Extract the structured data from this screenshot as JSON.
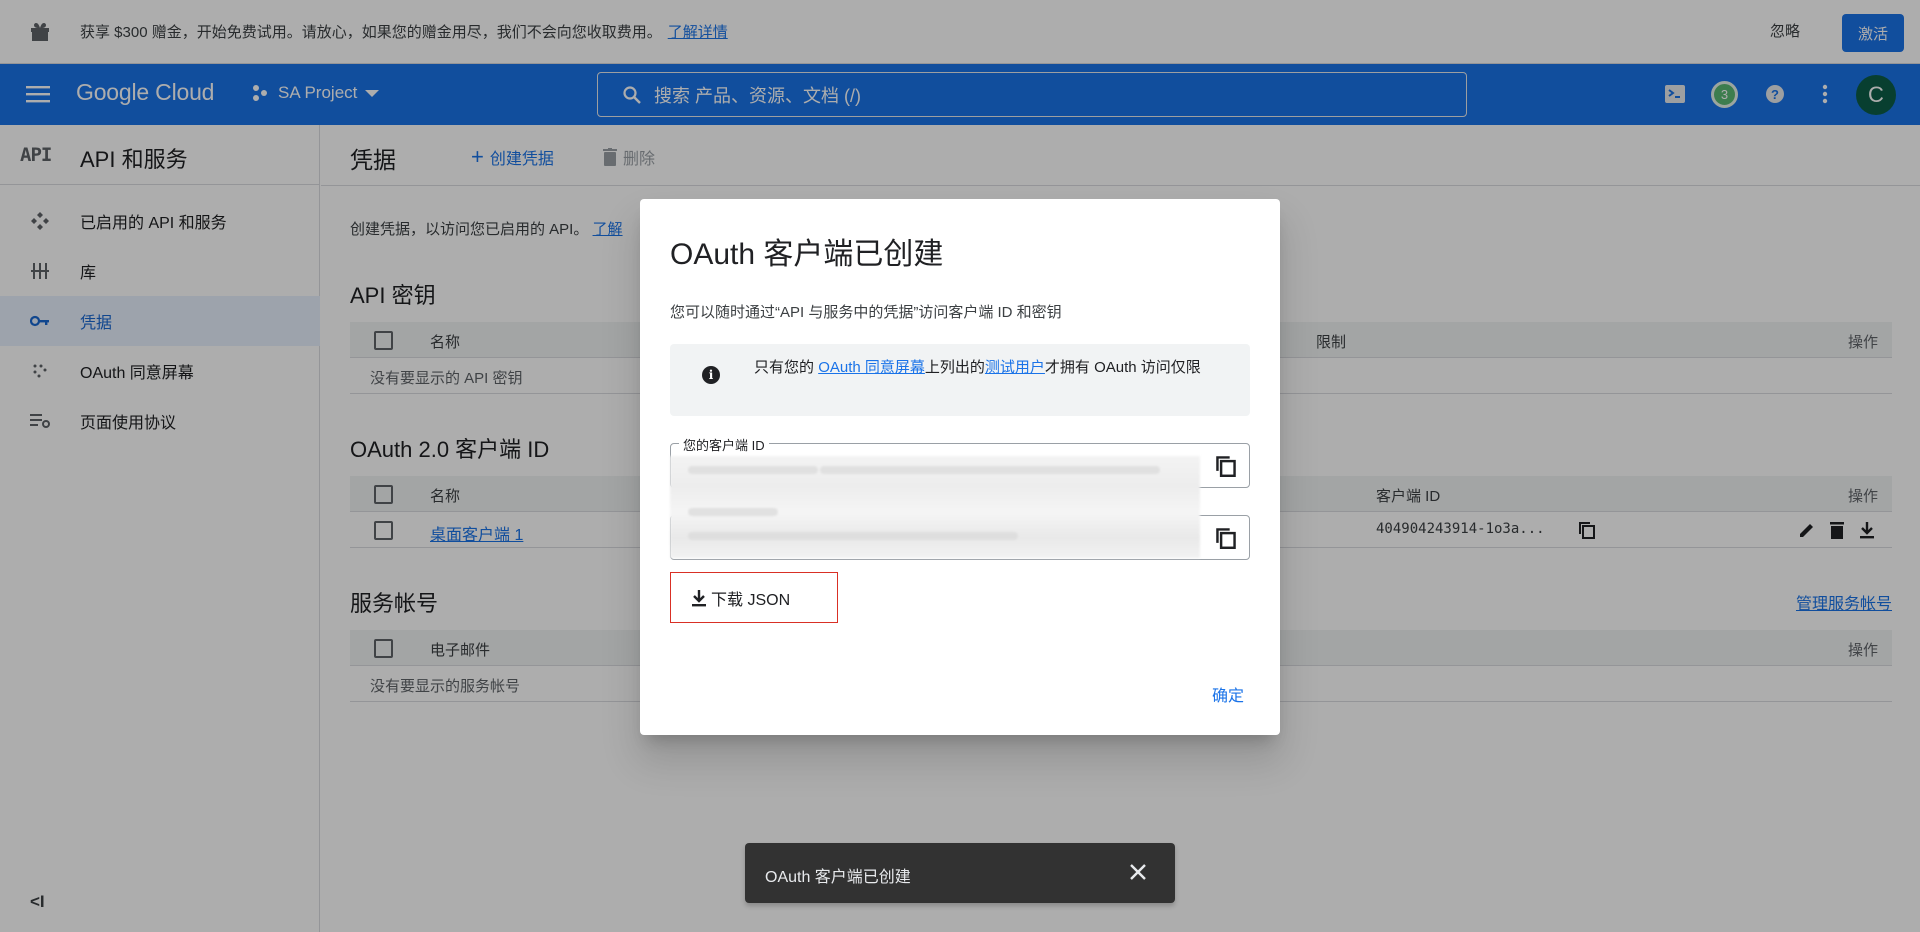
{
  "promo": {
    "text": "获享 $300 赠金，开始免费试用。请放心，如果您的赠金用尽，我们不会向您收取费用。",
    "link": "了解详情",
    "dismiss": "忽略",
    "activate": "激活"
  },
  "header": {
    "logo": "Google Cloud",
    "project": "SA Project",
    "search_placeholder": "搜索  产品、资源、文档 (/)",
    "notification_count": "3",
    "avatar_letter": "C"
  },
  "sidebar": {
    "badge": "API",
    "title": "API 和服务",
    "items": [
      {
        "label": "已启用的 API 和服务",
        "icon": "diamond-move-icon"
      },
      {
        "label": "库",
        "icon": "library-icon"
      },
      {
        "label": "凭据",
        "icon": "key-icon",
        "active": true
      },
      {
        "label": "OAuth 同意屏幕",
        "icon": "dots-grid-icon"
      },
      {
        "label": "页面使用协议",
        "icon": "settings-list-icon"
      }
    ],
    "collapse": "<I"
  },
  "main": {
    "title": "凭据",
    "create": "创建凭据",
    "delete": "删除",
    "description": "创建凭据，以访问您已启用的 API。",
    "description_link": "了解",
    "api_keys": {
      "title": "API 密钥",
      "col_name": "名称",
      "col_restrict": "限制",
      "col_actions": "操作",
      "empty": "没有要显示的 API 密钥"
    },
    "oauth": {
      "title": "OAuth 2.0 客户端 ID",
      "col_name": "名称",
      "col_client_id": "客户端 ID",
      "col_actions": "操作",
      "row_name": "桌面客户端 1",
      "row_client_id": "404904243914-1o3a..."
    },
    "service": {
      "title": "服务帐号",
      "manage": "管理服务帐号",
      "col_email": "电子邮件",
      "col_actions": "操作",
      "empty": "没有要显示的服务帐号"
    }
  },
  "dialog": {
    "title": "OAuth 客户端已创建",
    "subtitle": "您可以随时通过“API 与服务中的凭据”访问客户端 ID 和密钥",
    "info_prefix": "只有您的",
    "info_link1": "OAuth 同意屏幕",
    "info_mid": "上列出的",
    "info_link2": "测试用户",
    "info_suffix": "才拥有 OAuth 访问仅限",
    "client_id_label": "您的客户端 ID",
    "download": "下载 JSON",
    "ok": "确定"
  },
  "snackbar": {
    "text": "OAuth 客户端已创建"
  },
  "colors": {
    "brand_blue": "#1a73e8",
    "active_nav_bg": "#e8f0fe",
    "badge_green": "#5bb974",
    "avatar_bg": "#0d5e48",
    "highlight_red": "#d93025"
  }
}
